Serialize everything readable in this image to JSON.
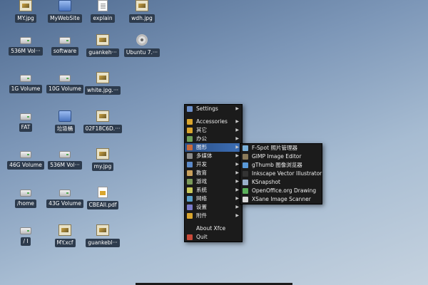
{
  "desktop_icons": [
    {
      "label": "MY.jpg",
      "kind": "image"
    },
    {
      "label": "MyWebSite",
      "kind": "folder"
    },
    {
      "label": "explain",
      "kind": "document"
    },
    {
      "label": "wdh.jpg",
      "kind": "image"
    },
    {
      "label": "536M Vol···",
      "kind": "drive"
    },
    {
      "label": "software",
      "kind": "drive"
    },
    {
      "label": "guankeh···",
      "kind": "image"
    },
    {
      "label": "Ubuntu 7.···",
      "kind": "cdrom"
    },
    {
      "label": "1G Volume",
      "kind": "drive"
    },
    {
      "label": "10G Volume",
      "kind": "drive"
    },
    {
      "label": "white.jpg.···",
      "kind": "image"
    },
    {
      "label": "FAT",
      "kind": "drive"
    },
    {
      "label": "垃圾桶",
      "kind": "trash"
    },
    {
      "label": "02F18C6D.···",
      "kind": "image"
    },
    {
      "label": "46G Volume",
      "kind": "drive"
    },
    {
      "label": "536M Vol···",
      "kind": "drive"
    },
    {
      "label": "my.jpg",
      "kind": "image"
    },
    {
      "label": "/home",
      "kind": "drive"
    },
    {
      "label": "43G Volume",
      "kind": "drive"
    },
    {
      "label": "CBEAll.pdf",
      "kind": "pdf"
    },
    {
      "label": "/ I",
      "kind": "drive"
    },
    {
      "label": "MY.xcf",
      "kind": "image"
    },
    {
      "label": "guankebl···",
      "kind": "image"
    }
  ],
  "root_menu": [
    {
      "label": "Settings",
      "has_submenu": true,
      "icon_color": "#6b8fc9"
    },
    {
      "separator": true
    },
    {
      "label": "Accessories",
      "has_submenu": true,
      "icon_color": "#d9a52e"
    },
    {
      "label": "其它",
      "has_submenu": true,
      "icon_color": "#d9a52e"
    },
    {
      "label": "办公",
      "has_submenu": true,
      "icon_color": "#6fa05a"
    },
    {
      "label": "图形",
      "has_submenu": true,
      "icon_color": "#c86a3a",
      "highlighted": true
    },
    {
      "label": "多媒体",
      "has_submenu": true,
      "icon_color": "#8a8a8a"
    },
    {
      "label": "开发",
      "has_submenu": true,
      "icon_color": "#5c8ac9"
    },
    {
      "label": "教育",
      "has_submenu": true,
      "icon_color": "#c9a05c"
    },
    {
      "label": "游戏",
      "has_submenu": true,
      "icon_color": "#7a9a5a"
    },
    {
      "label": "系统",
      "has_submenu": true,
      "icon_color": "#c9c95a"
    },
    {
      "label": "网络",
      "has_submenu": true,
      "icon_color": "#5aa0c9"
    },
    {
      "label": "设置",
      "has_submenu": true,
      "icon_color": "#7a7ac9"
    },
    {
      "label": "附件",
      "has_submenu": true,
      "icon_color": "#d9a52e"
    },
    {
      "separator": true
    },
    {
      "label": "About Xfce",
      "has_submenu": false,
      "icon_color": ""
    },
    {
      "label": "Quit",
      "has_submenu": false,
      "icon_color": "#c94a3a"
    }
  ],
  "graphics_submenu": [
    {
      "label": "F-Spot 照片管理器",
      "icon_color": "#7ab0d9"
    },
    {
      "label": "GIMP Image Editor",
      "icon_color": "#8a7a5a"
    },
    {
      "label": "gThumb 图像浏览器",
      "icon_color": "#5a9ad9"
    },
    {
      "label": "Inkscape Vector Illustrator",
      "icon_color": "#333333"
    },
    {
      "label": "KSnapshot",
      "icon_color": "#9ab0c9"
    },
    {
      "label": "OpenOffice.org Drawing",
      "icon_color": "#5ab05a"
    },
    {
      "label": "XSane Image Scanner",
      "icon_color": "#d9d9d9"
    }
  ]
}
